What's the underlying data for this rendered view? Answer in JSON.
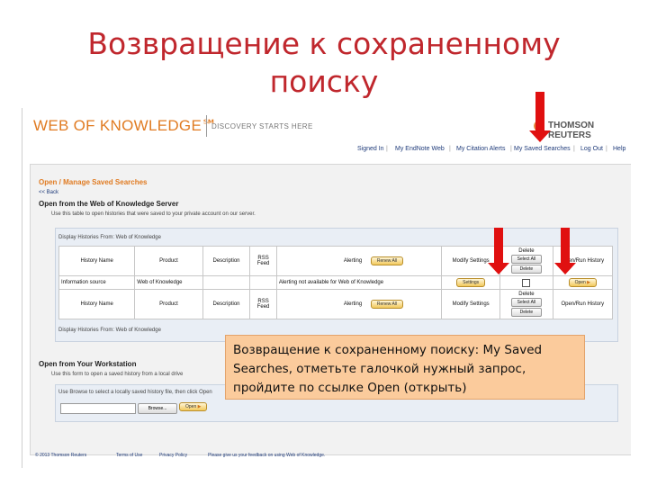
{
  "slide": {
    "title_line1": "Возвращение к сохраненному",
    "title_line2": "поиску",
    "callout": "Возвращение к сохраненному поиску: My Saved Searches, отметьте галочкой нужный запрос, пройдите по ссылке Open (открыть)",
    "accent_color": "#c0272d",
    "arrow_color": "#e01010",
    "callout_color": "#fbcb9c"
  },
  "app": {
    "brand": "WEB OF KNOWLEDGE℠",
    "tagline": "DISCOVERY STARTS HERE",
    "publisher": "THOMSON REUTERS",
    "nav": {
      "signed_in": "Signed In",
      "my_endnote_web": "My EndNote Web",
      "my_citation_alerts": "My Citation Alerts",
      "my_saved_searches": "My Saved Searches",
      "log_out": "Log Out",
      "help": "Help"
    },
    "page_title": "Open / Manage Saved Searches",
    "back_link": "<< Back",
    "server_section": {
      "heading": "Open from the Web of Knowledge Server",
      "description": "Use this table to open histories that were saved to your private account on our server.",
      "caption_top": "Display Histories From: Web of Knowledge",
      "caption_bottom": "Display Histories From: Web of Knowledge",
      "columns": {
        "history_name": "History Name",
        "product": "Product",
        "description": "Description",
        "rss_feed": "RSS Feed",
        "alerting": "Alerting",
        "renew_all": "Renew All",
        "modify_settings": "Modify Settings",
        "delete": "Delete",
        "select_all": "Select All",
        "delete_btn": "Delete",
        "open_run": "Open/Run History"
      },
      "row": {
        "history_name": "Information source",
        "product": "Web of Knowledge",
        "alerting_text": "Alerting not available for Web of Knowledge",
        "settings_btn": "Settings",
        "open_btn": "Open"
      }
    },
    "workstation_section": {
      "heading": "Open from Your Workstation",
      "description": "Use this form to open a saved history from a local drive",
      "caption": "Use Browse to select a locally saved history file, then click Open",
      "browse_btn": "Browse...",
      "open_btn": "Open"
    },
    "footer": {
      "copyright": "© 2013 Thomson Reuters",
      "terms": "Terms of Use",
      "privacy": "Privacy Policy",
      "feedback": "Please give us your feedback on using Web of Knowledge."
    }
  }
}
